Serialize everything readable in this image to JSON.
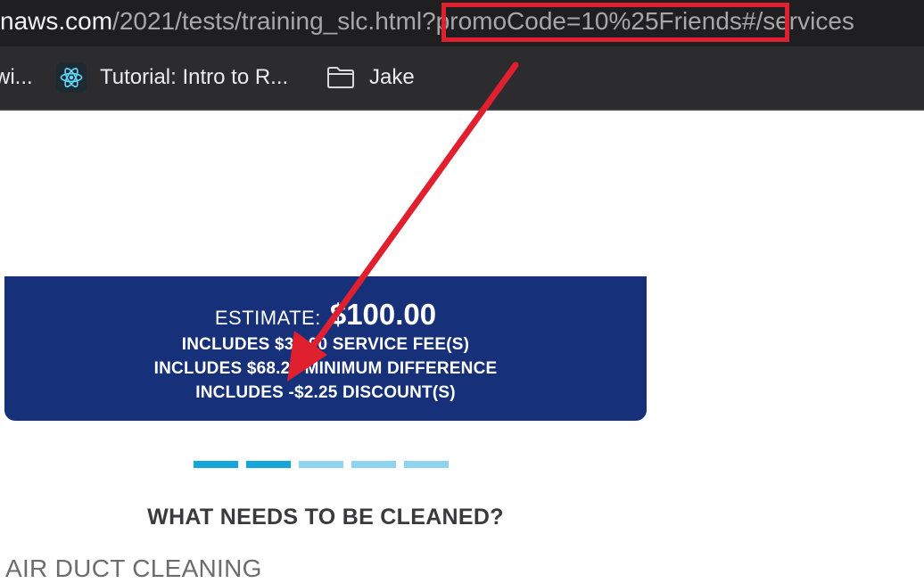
{
  "browser": {
    "url": {
      "host": "naws.com",
      "path": "/2021/tests/training_slc.html?promoCode=10%25Friends#/services"
    },
    "bookmarks": [
      {
        "label": "wi..."
      },
      {
        "label": "Tutorial: Intro to R..."
      },
      {
        "label": "Jake"
      }
    ]
  },
  "estimate": {
    "label": "ESTIMATE:",
    "amount": "$100.00",
    "lines": [
      "INCLUDES $34.00 SERVICE FEE(S)",
      "INCLUDES $68.25 MINIMUM DIFFERENCE",
      "INCLUDES -$2.25 DISCOUNT(S)"
    ]
  },
  "progress": {
    "steps_total": 5,
    "steps_completed": 2
  },
  "section": {
    "question": "WHAT NEEDS TO BE CLEANED?",
    "first_service": "AIR DUCT CLEANING"
  },
  "colors": {
    "estimate_bg": "#17307a",
    "step_done": "#16a5d8",
    "step_todo": "#8fd4ef",
    "annotation": "#e0202e"
  }
}
